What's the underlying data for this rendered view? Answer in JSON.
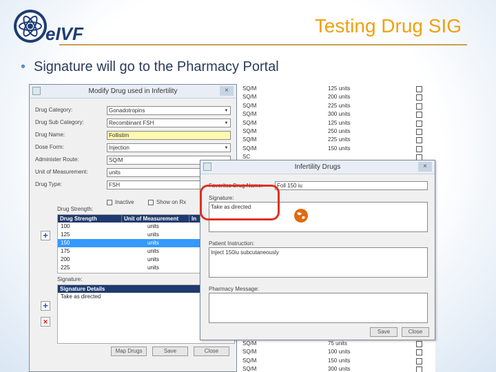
{
  "slide": {
    "logo_text": "eIVF",
    "title": "Testing Drug SIG",
    "bullet": "Signature will go to the Pharmacy Portal"
  },
  "colors": {
    "title": "#f0a010",
    "grid_header": "#1f3a6e",
    "selection": "#3399ff",
    "highlight": "#e03020"
  },
  "background_list": {
    "rows": [
      {
        "unit": "SQ/M",
        "amount": "125 units"
      },
      {
        "unit": "SQ/M",
        "amount": "200 units"
      },
      {
        "unit": "SQ/M",
        "amount": "225 units"
      },
      {
        "unit": "SQ/M",
        "amount": "300 units"
      },
      {
        "unit": "SQ/M",
        "amount": "125 units"
      },
      {
        "unit": "SQ/M",
        "amount": "250 units"
      },
      {
        "unit": "SQ/M",
        "amount": "225 units"
      },
      {
        "unit": "SQ/M",
        "amount": "150 units"
      },
      {
        "unit": "SC",
        "amount": ""
      }
    ],
    "bottom_rows": [
      {
        "unit": "SQ/M",
        "amount": "75 units"
      },
      {
        "unit": "SQ/M",
        "amount": "100 units"
      },
      {
        "unit": "SQ/M",
        "amount": "150 units"
      },
      {
        "unit": "SQ/M",
        "amount": "300 units"
      }
    ]
  },
  "modify_dialog": {
    "title": "Modify Drug used in Infertility",
    "close": "×",
    "fields": {
      "drug_category": {
        "label": "Drug Category:",
        "value": "Gonadotropins"
      },
      "drug_sub_category": {
        "label": "Drug Sub Category:",
        "value": "Recombinant FSH"
      },
      "drug_name": {
        "label": "Drug Name:",
        "value": "Follistim"
      },
      "dose_form": {
        "label": "Dose Form:",
        "value": "Injection"
      },
      "administer_route": {
        "label": "Administer Route:",
        "value": "SQ/M"
      },
      "unit_of_measurement": {
        "label": "Unit of Measurement:",
        "value": "units"
      },
      "drug_type": {
        "label": "Drug Type:",
        "value": "FSH"
      }
    },
    "inactive_label": "Inactive",
    "show_on_rx_label": "Show on Rx",
    "strength_label": "Drug Strength:",
    "strength_headers": [
      "Drug Strength",
      "Unit of Measurement",
      "In"
    ],
    "strength_rows": [
      {
        "strength": "100",
        "unit": "units",
        "selected": false
      },
      {
        "strength": "125",
        "unit": "units",
        "selected": false
      },
      {
        "strength": "150",
        "unit": "units",
        "selected": true
      },
      {
        "strength": "175",
        "unit": "units",
        "selected": false
      },
      {
        "strength": "200",
        "unit": "units",
        "selected": false
      },
      {
        "strength": "225",
        "unit": "units",
        "selected": false
      }
    ],
    "signature_label": "Signature:",
    "signature_header": "Signature Details",
    "signature_rows": [
      "Take as directed"
    ],
    "buttons": {
      "map_drugs": "Map Drugs",
      "save": "Save",
      "close": "Close"
    },
    "add_icon": "+",
    "remove_icon": "×"
  },
  "infertility_dialog": {
    "title": "Infertility Drugs",
    "close": "×",
    "name_label": "Favorites Drug Name:",
    "name_value": "Foll 150 iu",
    "signature_label": "Signature:",
    "signature_value": "Take as directed",
    "patient_instruction_label": "Patient Instruction:",
    "patient_instruction_value": "Inject 150iu subcutaneously",
    "pharmacy_message_label": "Pharmacy Message:",
    "pharmacy_message_value": "",
    "buttons": {
      "save": "Save",
      "close": "Close"
    }
  }
}
